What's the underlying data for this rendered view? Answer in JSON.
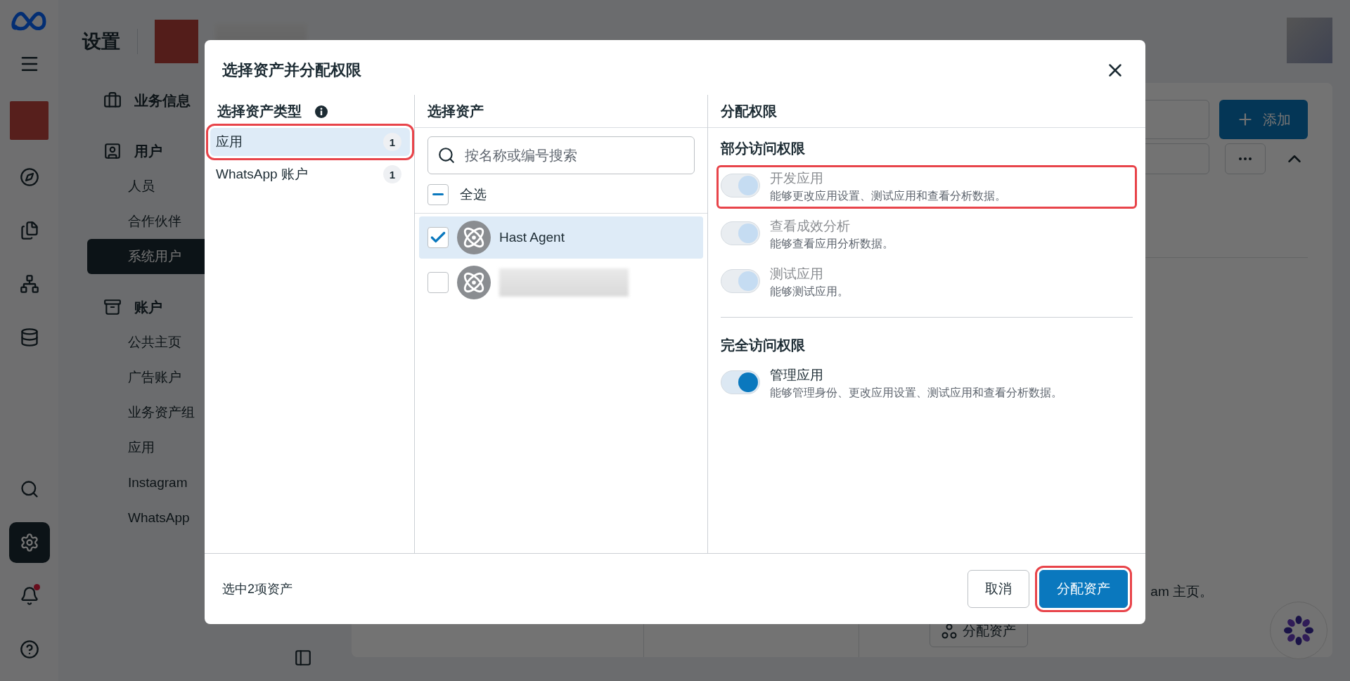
{
  "rail": {
    "top_items": [
      {
        "kind": "compass",
        "selected": false
      },
      {
        "kind": "documents",
        "selected": false
      },
      {
        "kind": "network",
        "selected": false
      },
      {
        "kind": "stack",
        "selected": false
      }
    ],
    "bottom_items": [
      {
        "kind": "search",
        "selected": false,
        "has_badge": false
      },
      {
        "kind": "settings",
        "selected": true,
        "has_badge": false
      },
      {
        "kind": "notifications",
        "selected": false,
        "has_badge": true
      },
      {
        "kind": "help",
        "selected": false,
        "has_badge": false
      }
    ]
  },
  "settings_nav": {
    "title": "设置",
    "sections": [
      {
        "kind": "business",
        "label": "业务信息"
      },
      {
        "kind": "users",
        "label": "用户",
        "items": [
          {
            "label": "人员",
            "selected": false
          },
          {
            "label": "合作伙伴",
            "selected": false
          },
          {
            "label": "系统用户",
            "selected": true
          }
        ]
      },
      {
        "kind": "accounts",
        "label": "账户",
        "items": [
          {
            "label": "公共主页",
            "selected": false
          },
          {
            "label": "广告账户",
            "selected": false
          },
          {
            "label": "业务资产组",
            "selected": false
          },
          {
            "label": "应用",
            "selected": false
          },
          {
            "label": "Instagram",
            "selected": false
          },
          {
            "label": "WhatsApp",
            "selected": false
          }
        ]
      }
    ]
  },
  "main": {
    "add_button": "添加",
    "note": "am 主页。",
    "assign_button": "分配资产"
  },
  "dialog": {
    "title": "选择资产并分配权限",
    "asset_types": {
      "heading": "选择资产类型",
      "items": [
        {
          "label": "应用",
          "count": "1",
          "selected": true,
          "highlighted": true
        },
        {
          "label": "WhatsApp 账户",
          "count": "1",
          "selected": false,
          "highlighted": false
        }
      ]
    },
    "assets": {
      "heading": "选择资产",
      "search": {
        "placeholder": "按名称或编号搜索"
      },
      "select_all": {
        "label": "全选",
        "indeterminate": true
      },
      "items": [
        {
          "name": "Hast Agent",
          "checked": true,
          "selected": true
        },
        {
          "checked": false,
          "selected": false
        }
      ]
    },
    "permissions": {
      "heading": "分配权限",
      "groups": [
        {
          "title": "部分访问权限",
          "items": [
            {
              "label": "开发应用",
              "description": "能够更改应用设置、测试应用和查看分析数据。",
              "on": true,
              "disabled": true,
              "highlighted": true
            },
            {
              "label": "查看成效分析",
              "description": "能够查看应用分析数据。",
              "on": true,
              "disabled": true,
              "highlighted": false
            },
            {
              "label": "测试应用",
              "description": "能够测试应用。",
              "on": true,
              "disabled": true,
              "highlighted": false
            }
          ]
        },
        {
          "title": "完全访问权限",
          "items": [
            {
              "label": "管理应用",
              "description": "能够管理身份、更改应用设置、测试应用和查看分析数据。",
              "on": true,
              "disabled": false,
              "highlighted": false
            }
          ]
        }
      ]
    },
    "footer": {
      "summary": "选中2项资产",
      "buttons": [
        {
          "label": "取消",
          "kind": "secondary",
          "highlighted": false
        },
        {
          "label": "分配资产",
          "kind": "primary",
          "highlighted": true
        }
      ]
    }
  }
}
